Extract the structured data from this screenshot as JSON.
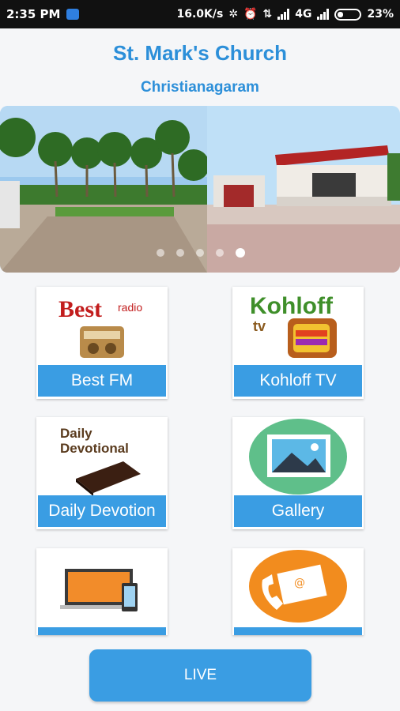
{
  "status_bar": {
    "time": "2:35 PM",
    "net_speed": "16.0K/s",
    "network": "4G",
    "battery": "23%"
  },
  "header": {
    "title": "St. Mark's Church",
    "subtitle": "Christianagaram"
  },
  "banner": {
    "slide_count": 5,
    "active_slide": 5
  },
  "tiles": [
    {
      "label": "Best FM",
      "icon": "best-radio-logo",
      "logo_text": "Best radio"
    },
    {
      "label": "Kohloff TV",
      "icon": "kohloff-tv-logo",
      "logo_text": "Kohloff tv"
    },
    {
      "label": "Daily Devotion",
      "icon": "bible-icon",
      "logo_text": "Daily Devotional"
    },
    {
      "label": "Gallery",
      "icon": "gallery-icon"
    },
    {
      "label": "",
      "icon": "devices-icon"
    },
    {
      "label": "",
      "icon": "contact-icon"
    }
  ],
  "live_button": {
    "label": "LIVE"
  },
  "colors": {
    "accent": "#3a9de3",
    "title": "#2c8fd9"
  }
}
